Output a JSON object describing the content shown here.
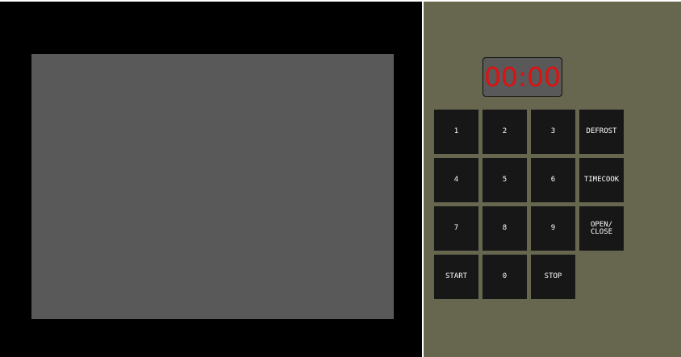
{
  "display": {
    "time": "00:00",
    "digit_color": "#e01010"
  },
  "colors": {
    "door": "#000000",
    "window": "#595959",
    "panel": "#67664f",
    "key": "#171717"
  },
  "keypad": {
    "k1": "1",
    "k2": "2",
    "k3": "3",
    "defrost": "DEFROST",
    "k4": "4",
    "k5": "5",
    "k6": "6",
    "timecook": "TIMECOOK",
    "k7": "7",
    "k8": "8",
    "k9": "9",
    "open_close": "OPEN/\nCLOSE",
    "start": "START",
    "k0": "0",
    "stop": "STOP"
  }
}
